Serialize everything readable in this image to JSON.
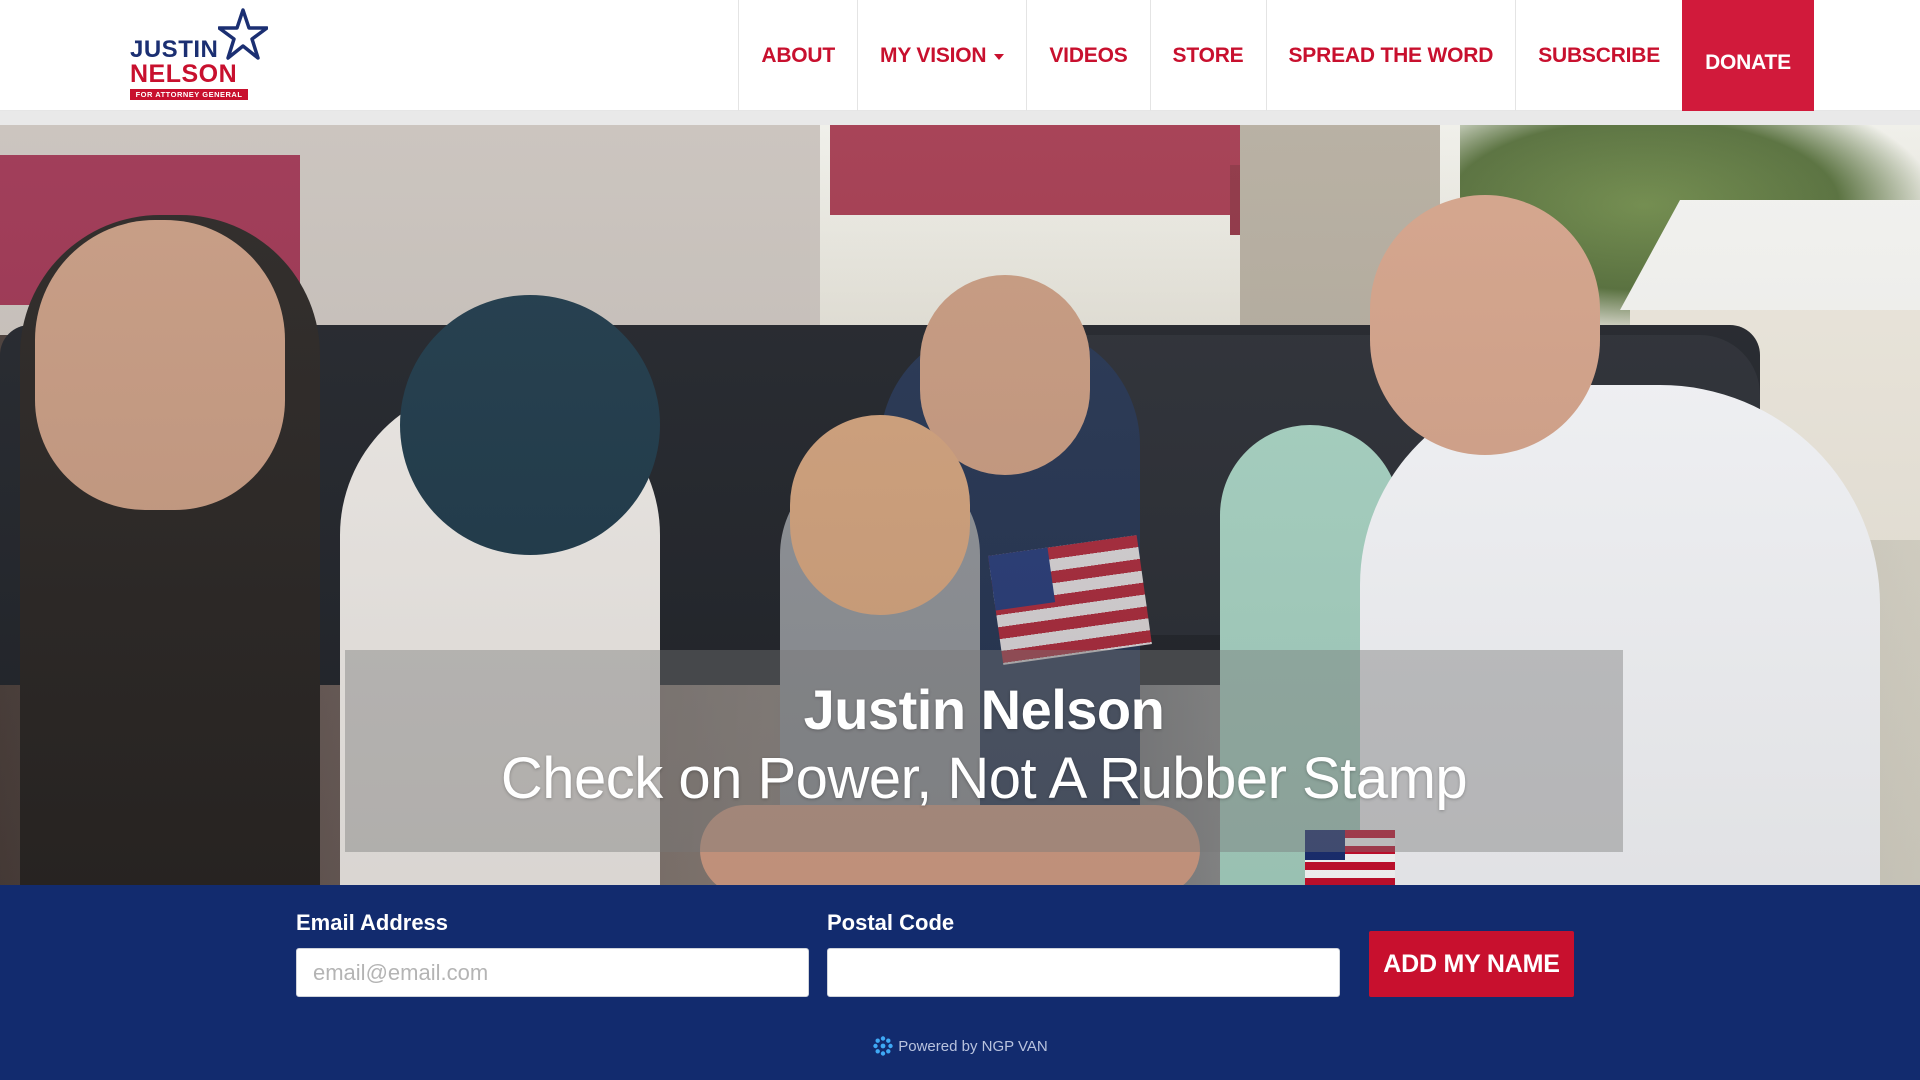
{
  "logo": {
    "line1": "JUSTIN",
    "line2": "NELSON",
    "tagline": "FOR ATTORNEY GENERAL"
  },
  "nav": {
    "items": [
      {
        "label": "ABOUT"
      },
      {
        "label": "MY VISION",
        "has_dropdown": true
      },
      {
        "label": "VIDEOS"
      },
      {
        "label": "STORE"
      },
      {
        "label": "SPREAD THE WORD"
      },
      {
        "label": "SUBSCRIBE"
      },
      {
        "label": "DONATE",
        "highlight": true
      }
    ]
  },
  "hero": {
    "name": "Justin Nelson",
    "tagline": "Check on Power, Not A Rubber Stamp"
  },
  "signup": {
    "email_label": "Email Address",
    "email_placeholder": "email@email.com",
    "email_value": "",
    "postal_label": "Postal Code",
    "postal_placeholder": "",
    "postal_value": "",
    "submit_label": "ADD MY NAME",
    "powered_by": "Powered by NGP VAN"
  },
  "colors": {
    "brand_red": "#c8102e",
    "brand_navy": "#122b6e",
    "donate_bg": "#d11a3b"
  }
}
